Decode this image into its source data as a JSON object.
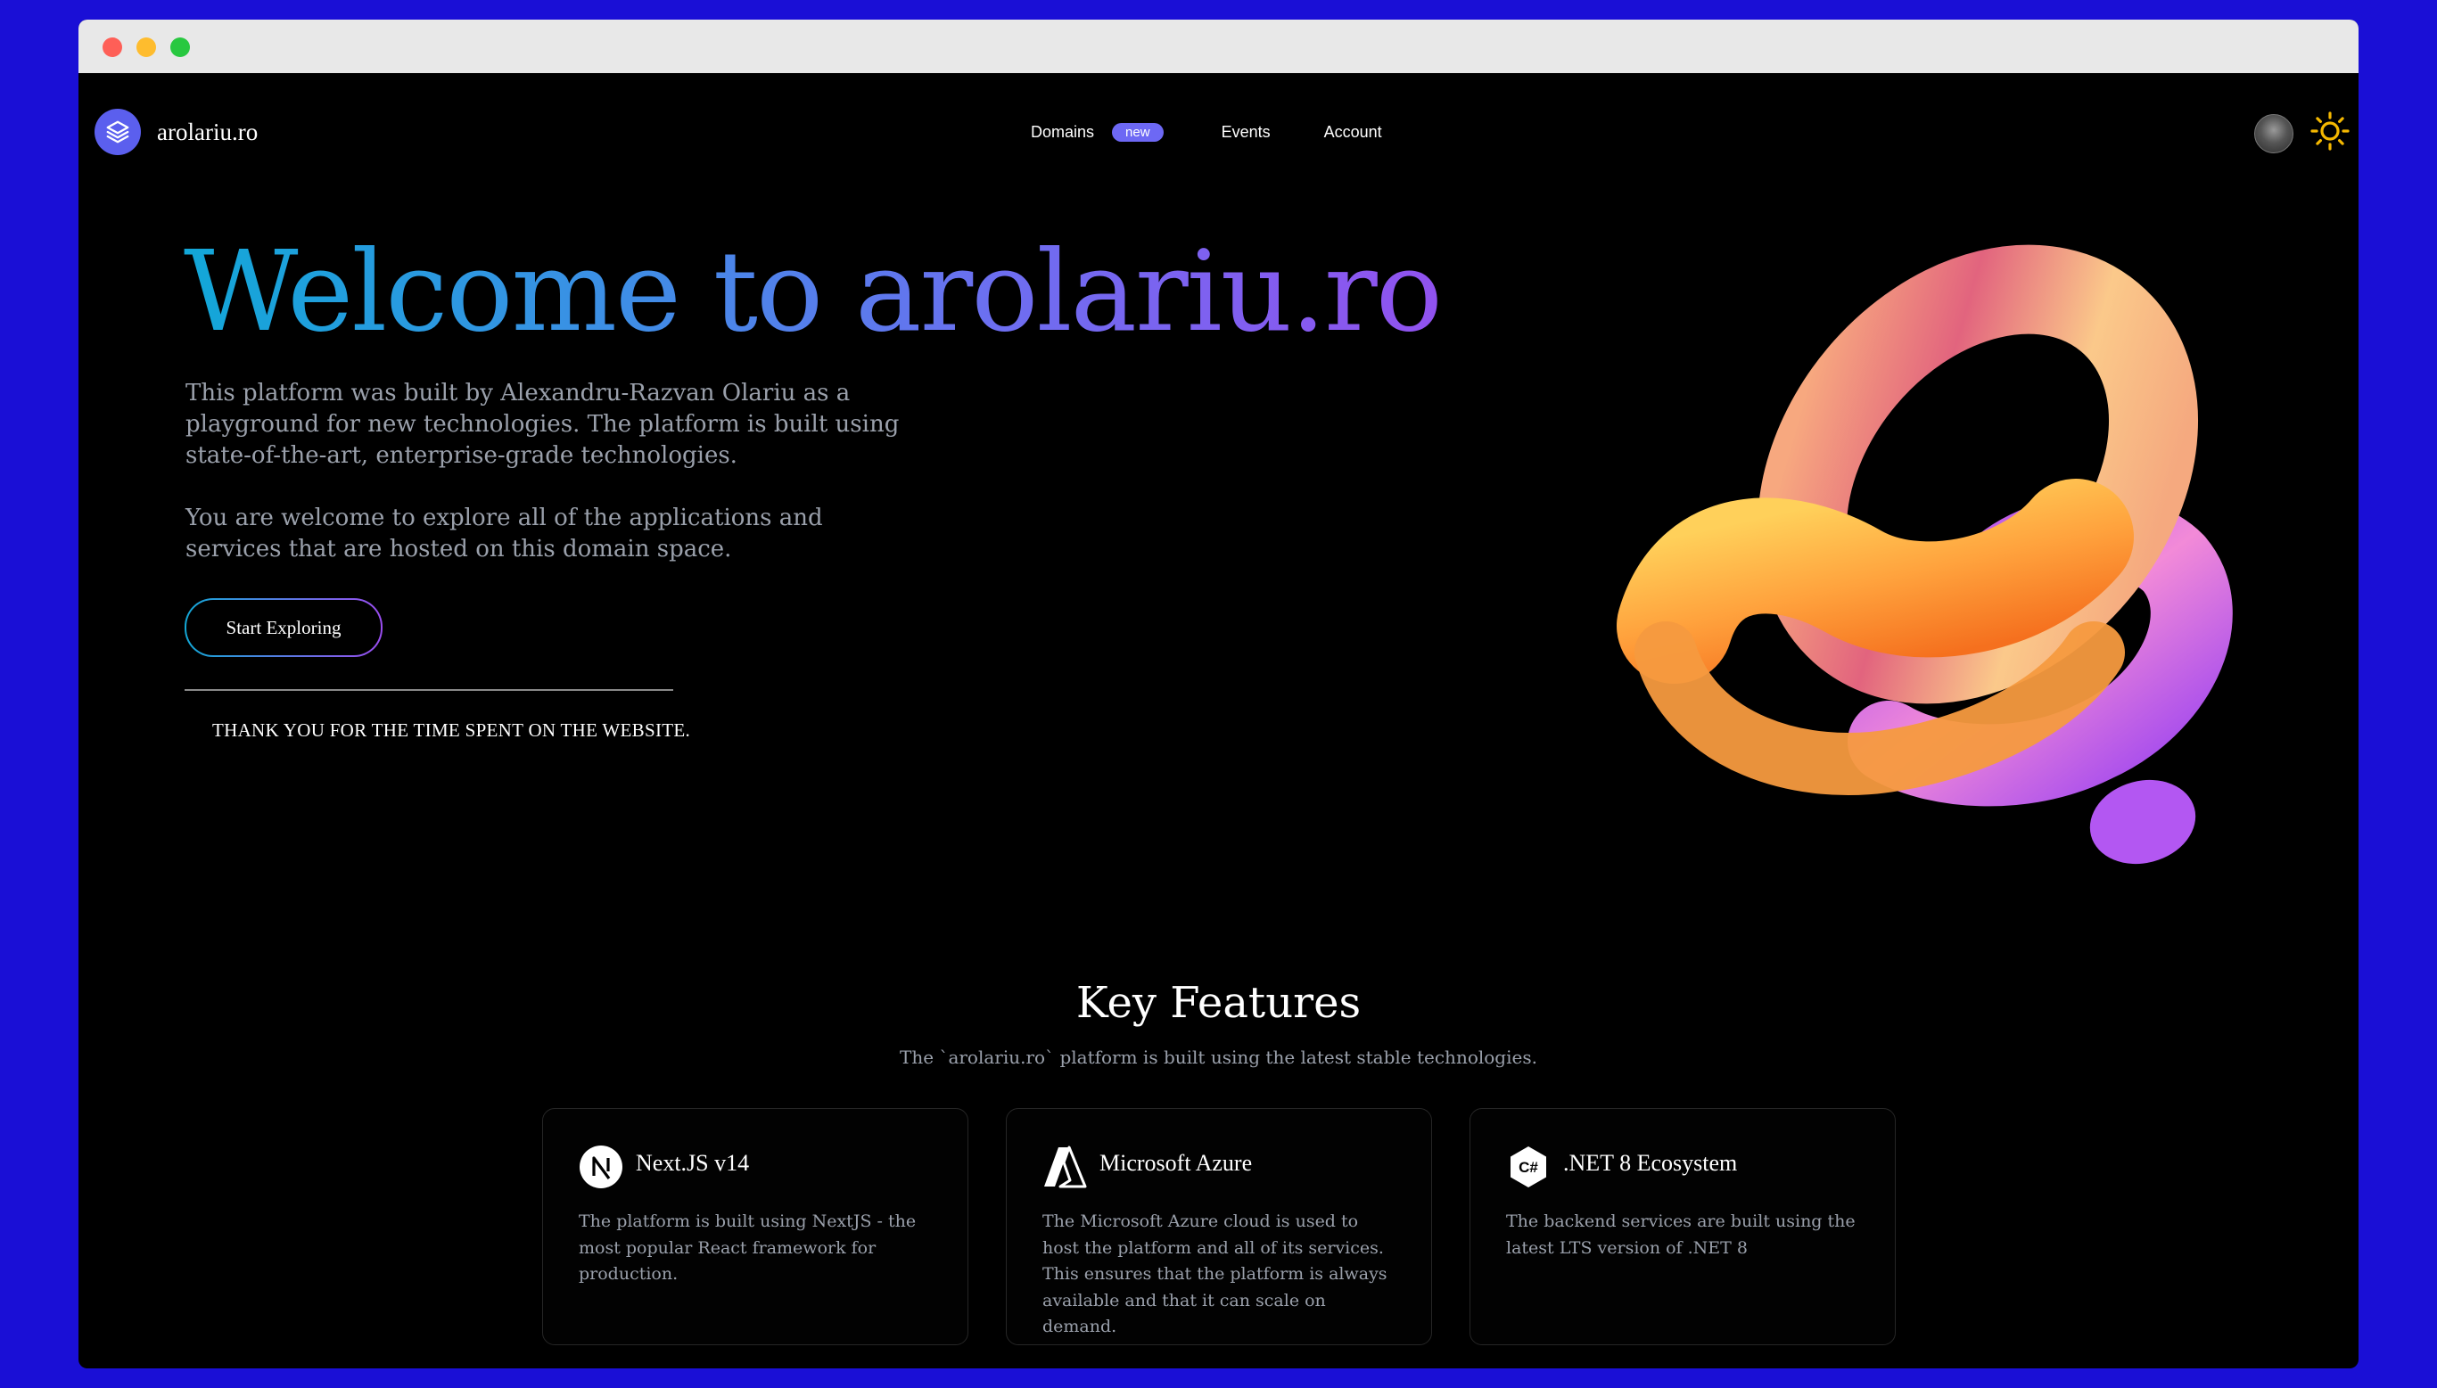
{
  "brand": {
    "name": "arolariu.ro",
    "logo_icon": "layers-icon",
    "accent": "#5b5fee"
  },
  "nav": {
    "links": [
      {
        "label": "Domains",
        "badge": "new"
      },
      {
        "label": "Events"
      },
      {
        "label": "Account"
      }
    ],
    "avatar_icon": "user-avatar",
    "theme_icon": "sun-icon"
  },
  "hero": {
    "title": "Welcome to arolariu.ro",
    "paragraph1": "This platform was built by Alexandru-Razvan Olariu as a playground for new technologies. The platform is built using state-of-the-art, enterprise-grade technologies.",
    "paragraph2": "You are welcome to explore all of the applications and services that are hosted on this domain space.",
    "cta_label": "Start Exploring",
    "thanks": "THANK YOU FOR THE TIME SPENT ON THE WEBSITE.",
    "gradient": [
      "#12a7d8",
      "#9152ef"
    ]
  },
  "features": {
    "title": "Key Features",
    "subtitle": "The `arolariu.ro` platform is built using the latest stable technologies.",
    "cards": [
      {
        "icon": "nextjs-icon",
        "title": "Next.JS v14",
        "text": "The platform is built using NextJS - the most popular React framework for production."
      },
      {
        "icon": "azure-icon",
        "title": "Microsoft Azure",
        "text": "The Microsoft Azure cloud is used to host the platform and all of its services. This ensures that the platform is always available and that it can scale on demand."
      },
      {
        "icon": "csharp-icon",
        "title": ".NET 8 Ecosystem",
        "text": "The backend services are built using the latest LTS version of .NET 8"
      }
    ]
  }
}
